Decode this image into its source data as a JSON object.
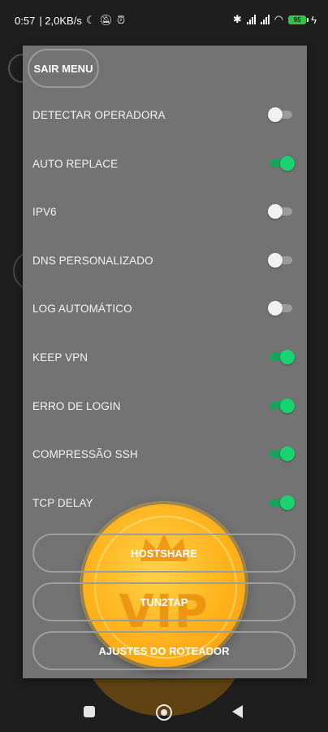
{
  "status_bar": {
    "time": "0:57",
    "network_speed": "| 2,0KB/s",
    "battery": "95"
  },
  "menu": {
    "close_label": "SAIR MENU",
    "options": [
      {
        "label": "DETECTAR OPERADORA",
        "on": false
      },
      {
        "label": "AUTO REPLACE",
        "on": true
      },
      {
        "label": "IPV6",
        "on": false
      },
      {
        "label": "DNS PERSONALIZADO",
        "on": false
      },
      {
        "label": "LOG AUTOMÁTICO",
        "on": false
      },
      {
        "label": "KEEP VPN",
        "on": true
      },
      {
        "label": "ERRO DE LOGIN",
        "on": true
      },
      {
        "label": "COMPRESSÃO SSH",
        "on": true
      },
      {
        "label": "TCP DELAY",
        "on": true
      }
    ],
    "buttons": [
      "HOSTSHARE",
      "TUN2TAP",
      "AJUSTES DO ROTEADOR"
    ]
  },
  "vip_badge": {
    "text": "VIP"
  },
  "colors": {
    "panel": "#737373",
    "switch_on": "#19d36e",
    "coin": "#ffb21a"
  }
}
